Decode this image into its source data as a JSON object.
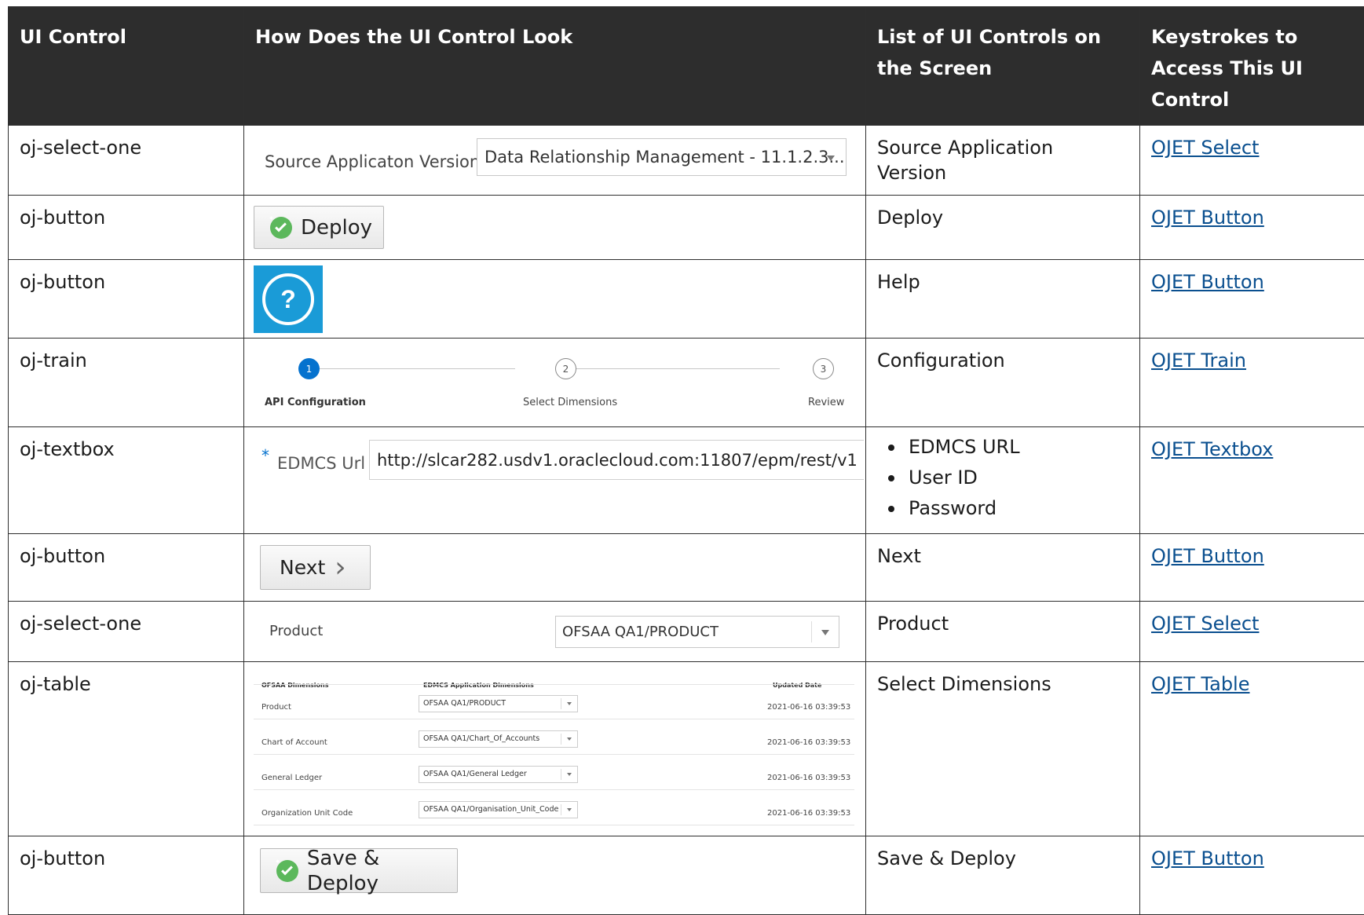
{
  "headers": [
    "UI Control",
    "How Does the UI Control Look",
    "List of UI Controls on the Screen",
    "Keystrokes to Access This UI Control"
  ],
  "rows": [
    {
      "control": "oj-select-one",
      "screen_items": [
        "Source Application Version"
      ],
      "link": "OJET Select"
    },
    {
      "control": "oj-button",
      "screen_items": [
        "Deploy"
      ],
      "link": "OJET Button"
    },
    {
      "control": "oj-button",
      "screen_items": [
        "Help"
      ],
      "link": "OJET Button"
    },
    {
      "control": "oj-train",
      "screen_items": [
        "Configuration"
      ],
      "link": "OJET Train"
    },
    {
      "control": "oj-textbox",
      "screen_items": [
        "EDMCS URL",
        "User ID",
        "Password"
      ],
      "link": "OJET Textbox"
    },
    {
      "control": "oj-button",
      "screen_items": [
        "Next"
      ],
      "link": "OJET Button"
    },
    {
      "control": "oj-select-one",
      "screen_items": [
        "Product"
      ],
      "link": "OJET Select"
    },
    {
      "control": "oj-table",
      "screen_items": [
        "Select Dimensions"
      ],
      "link": "OJET Table"
    },
    {
      "control": "oj-button",
      "screen_items": [
        "Save & Deploy"
      ],
      "link": "OJET Button"
    }
  ],
  "previews": {
    "source_select": {
      "label": "Source Applicaton Version:",
      "value": "Data Relationship Management - 11.1.2.3..."
    },
    "deploy_button": {
      "label": "Deploy"
    },
    "help_button": {
      "glyph": "?",
      "color": "#1a9bd7"
    },
    "train": {
      "steps": [
        {
          "number": "1",
          "label": "API Configuration"
        },
        {
          "number": "2",
          "label": "Select Dimensions"
        },
        {
          "number": "3",
          "label": "Review"
        }
      ],
      "active_color": "#0572ce"
    },
    "textbox": {
      "required_mark": "*",
      "label": "EDMCS Url",
      "value": "http://slcar282.usdv1.oraclecloud.com:11807/epm/rest/v1"
    },
    "next_button": {
      "label": "Next",
      "glyph": "›"
    },
    "product_select": {
      "label": "Product",
      "value": "OFSAA QA1/PRODUCT"
    },
    "dim_table": {
      "headers": [
        "OFSAA Dimensions",
        "EDMCS Application Dimensions",
        "Updated Date"
      ],
      "rows": [
        {
          "dimension": "Product",
          "edmcs": "OFSAA QA1/PRODUCT",
          "date": "2021-06-16 03:39:53"
        },
        {
          "dimension": "Chart of Account",
          "edmcs": "OFSAA QA1/Chart_Of_Accounts",
          "date": "2021-06-16 03:39:53"
        },
        {
          "dimension": "General Ledger",
          "edmcs": "OFSAA QA1/General Ledger",
          "date": "2021-06-16 03:39:53"
        },
        {
          "dimension": "Organization Unit Code",
          "edmcs": "OFSAA QA1/Organisation_Unit_Code",
          "date": "2021-06-16 03:39:53"
        }
      ]
    },
    "save_deploy_button": {
      "label": "Save & Deploy"
    }
  }
}
